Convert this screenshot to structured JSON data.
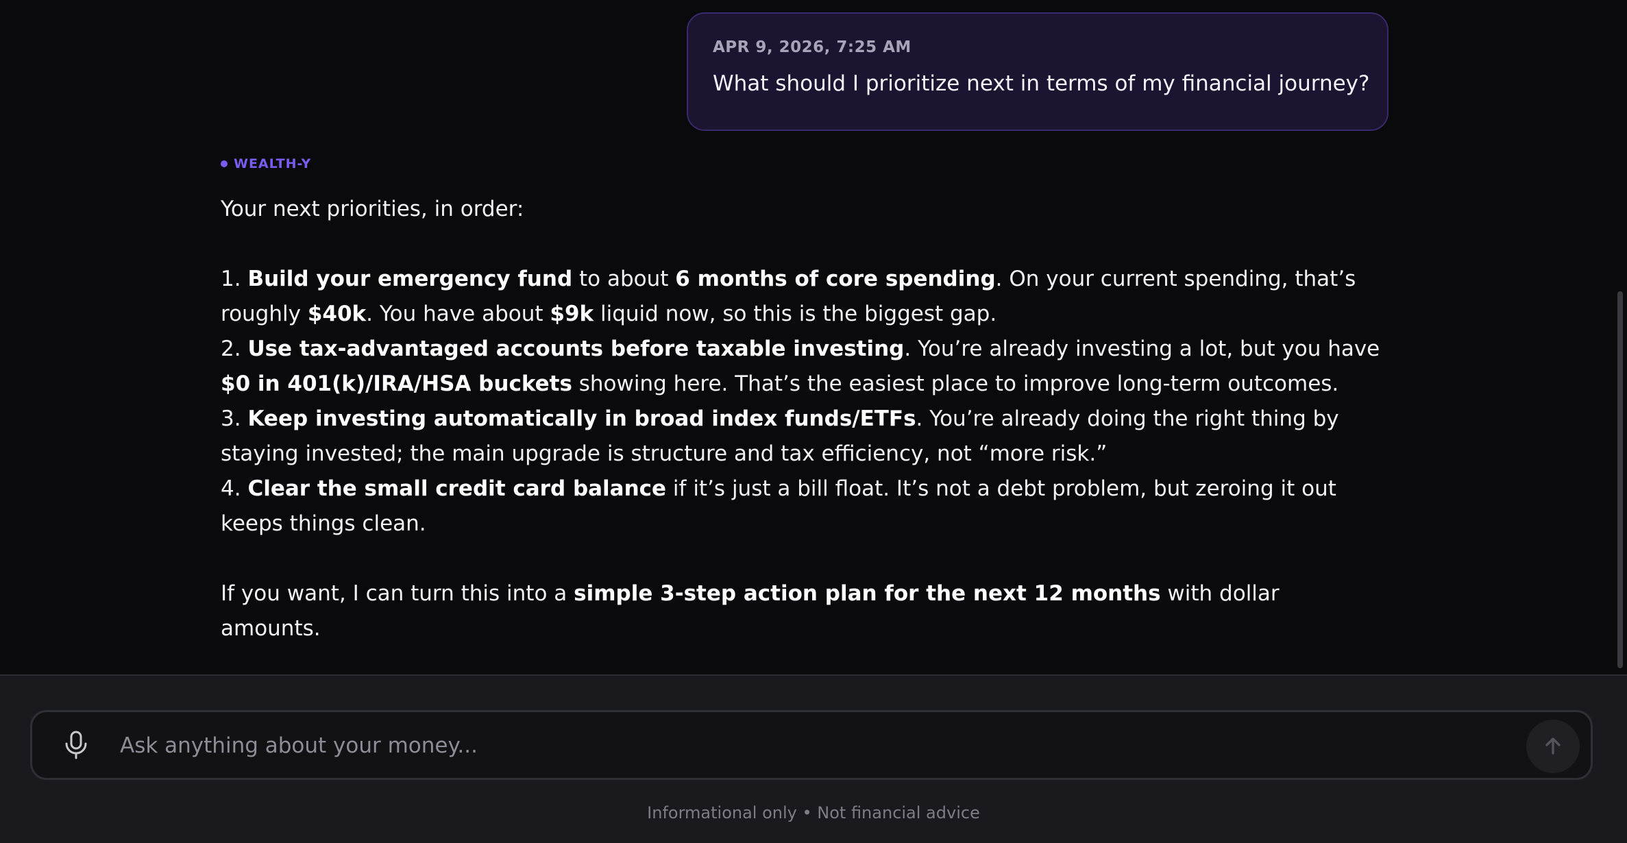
{
  "user_message": {
    "timestamp": "APR 9, 2026, 7:25 AM",
    "text": "What should I prioritize next in terms of my financial journey?"
  },
  "assistant": {
    "label": "WEALTH-Y",
    "intro": "Your next priorities, in order:",
    "items": [
      {
        "num": "1. ",
        "p1": "Build your emergency fund",
        "p2": " to about ",
        "p3": "6 months of core spending",
        "p4": ". On your current spending, that’s roughly ",
        "p5": "$40k",
        "p6": ". You have about ",
        "p7": "$9k",
        "p8": " liquid now, so this is the biggest gap."
      },
      {
        "num": "2. ",
        "p1": "Use tax-advantaged accounts before taxable investing",
        "p2": ". You’re already investing a lot, but you have ",
        "p3": "$0 in 401(k)/IRA/HSA buckets",
        "p4": " showing here. That’s the easiest place to improve long-term outcomes."
      },
      {
        "num": "3. ",
        "p1": "Keep investing automatically in broad index funds/ETFs",
        "p2": ". You’re already doing the right thing by staying invested; the main upgrade is structure and tax efficiency, not “more risk.”"
      },
      {
        "num": "4. ",
        "p1": "Clear the small credit card balance",
        "p2": " if it’s just a bill float. It’s not a debt problem, but zeroing it out keeps things clean."
      }
    ],
    "closing": {
      "p1": "If you want, I can turn this into a ",
      "p2": "simple 3-step action plan for the next 12 months",
      "p3": " with dollar amounts."
    }
  },
  "composer": {
    "placeholder": "Ask anything about your money...",
    "value": "",
    "mic_icon": "microphone-icon",
    "send_icon": "arrow-up-icon"
  },
  "disclaimer": "Informational only • Not financial advice",
  "colors": {
    "accent": "#7b5cf0",
    "background": "#0a0a0c",
    "user_bubble": "#1c1430",
    "panel": "#1a1a1e"
  }
}
